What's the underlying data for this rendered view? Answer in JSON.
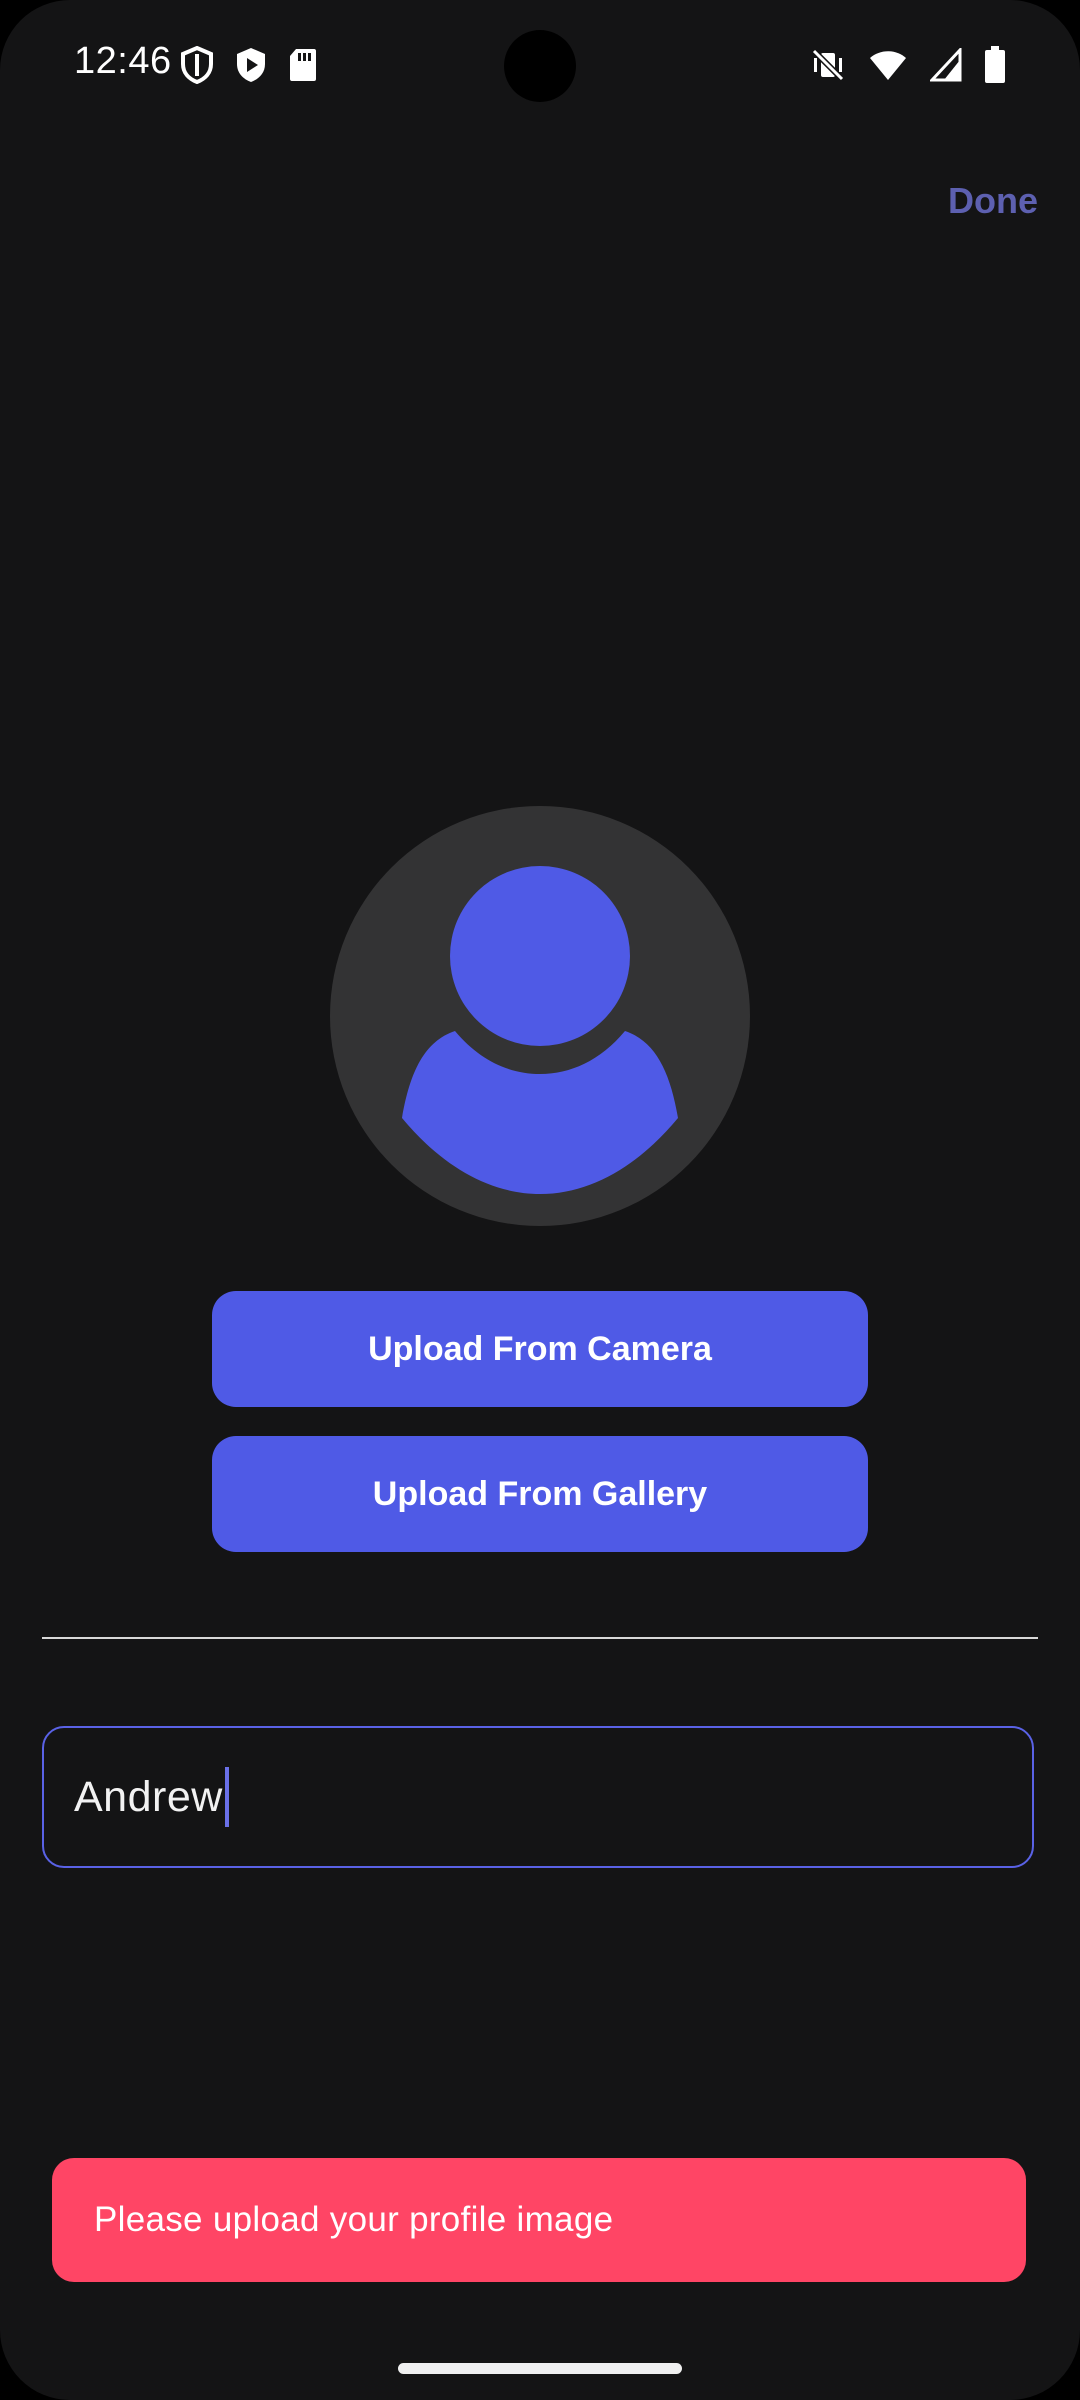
{
  "status_bar": {
    "time": "12:46",
    "left_icons": [
      "shield-icon",
      "play-protect-icon",
      "sd-card-icon"
    ],
    "right_icons": [
      "vibrate-off-icon",
      "wifi-icon",
      "signal-icon",
      "battery-icon"
    ]
  },
  "header": {
    "done_label": "Done"
  },
  "profile": {
    "avatar_icon": "person-placeholder-icon",
    "upload_camera_label": "Upload From Camera",
    "upload_gallery_label": "Upload From Gallery"
  },
  "name_input": {
    "value": "Andrew"
  },
  "snackbar": {
    "message": "Please upload your profile image"
  },
  "colors": {
    "background": "#141415",
    "accent": "#4f5ae6",
    "done_text": "#5d60b0",
    "avatar_bg": "#333334",
    "error": "#ff4565"
  }
}
